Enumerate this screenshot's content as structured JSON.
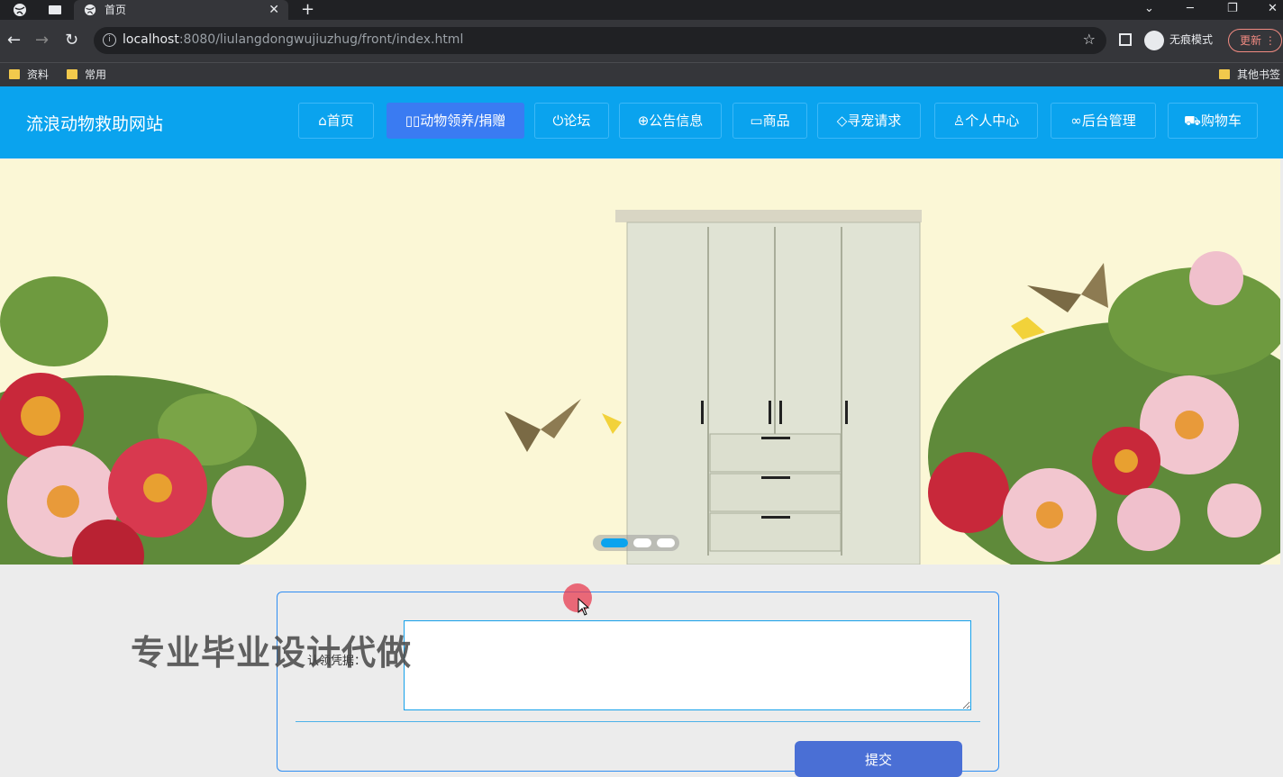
{
  "browser": {
    "tab_title": "首页",
    "url_host": "localhost",
    "url_rest": ":8080/liulangdongwujiuzhug/front/index.html",
    "incognito_label": "无痕模式",
    "update_label": "更新",
    "bookmarks": [
      "资料",
      "常用"
    ],
    "other_bookmarks": "其他书签"
  },
  "site": {
    "title": "流浪动物救助网站",
    "nav": [
      {
        "label": "首页",
        "icon": "home-icon"
      },
      {
        "label": "动物领养/捐赠",
        "icon": "grid-icon"
      },
      {
        "label": "论坛",
        "icon": "power-icon"
      },
      {
        "label": "公告信息",
        "icon": "globe-icon"
      },
      {
        "label": "商品",
        "icon": "book-icon"
      },
      {
        "label": "寻宠请求",
        "icon": "tag-icon"
      },
      {
        "label": "个人中心",
        "icon": "user-icon"
      },
      {
        "label": "后台管理",
        "icon": "link-icon"
      },
      {
        "label": "购物车",
        "icon": "cart-icon"
      }
    ],
    "active_nav_index": 1
  },
  "carousel": {
    "slide_count": 3,
    "active_slide": 0
  },
  "form": {
    "field_label": "认领凭据：",
    "field_value": "",
    "submit_label": "提交"
  },
  "overlay": {
    "watermark": "专业毕业设计代做"
  },
  "colors": {
    "header": "#0aa3ee",
    "active_nav": "#3a7bf2",
    "submit": "#4a6fd5"
  }
}
